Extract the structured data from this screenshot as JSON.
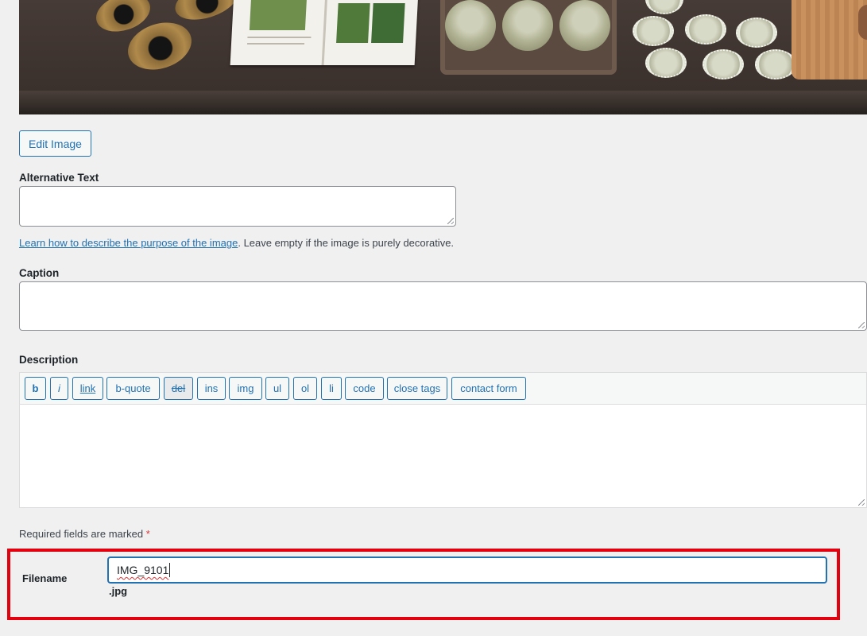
{
  "media": {
    "edit_image_label": "Edit Image"
  },
  "alt_text": {
    "label": "Alternative Text",
    "value": "",
    "help_link": "Learn how to describe the purpose of the image",
    "help_rest": ". Leave empty if the image is purely decorative."
  },
  "caption": {
    "label": "Caption",
    "value": ""
  },
  "description": {
    "label": "Description",
    "value": "",
    "quicktags": [
      "b",
      "i",
      "link",
      "b-quote",
      "del",
      "ins",
      "img",
      "ul",
      "ol",
      "li",
      "code",
      "close tags",
      "contact form"
    ]
  },
  "required_note": {
    "text": "Required fields are marked ",
    "star": "*"
  },
  "filename": {
    "label": "Filename",
    "value": "IMG_9101",
    "extension": ".jpg"
  },
  "colors": {
    "accent": "#2271b1",
    "highlight_border": "#e3000f",
    "background": "#f0f0f1"
  }
}
